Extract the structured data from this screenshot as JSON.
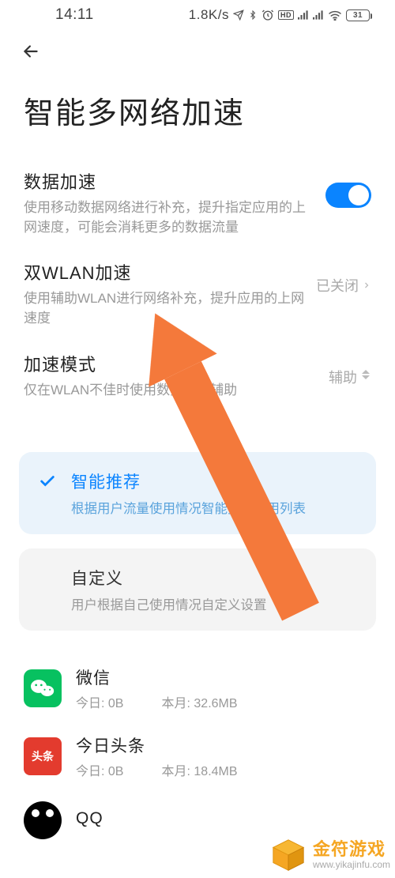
{
  "status": {
    "time": "14:11",
    "net_speed": "1.8K/s",
    "battery_pct": "31"
  },
  "header": {
    "title": "智能多网络加速"
  },
  "settings": {
    "data_accel": {
      "title": "数据加速",
      "desc": "使用移动数据网络进行补充，提升指定应用的上网速度，可能会消耗更多的数据流量",
      "enabled": true
    },
    "dual_wlan": {
      "title": "双WLAN加速",
      "desc": "使用辅助WLAN进行网络补充，提升应用的上网速度",
      "value": "已关闭"
    },
    "mode": {
      "title": "加速模式",
      "desc": "仅在WLAN不佳时使用数据流量辅助",
      "value": "辅助"
    }
  },
  "cards": {
    "recommend": {
      "title": "智能推荐",
      "desc": "根据用户流量使用情况智能推荐应用列表",
      "selected": true
    },
    "custom": {
      "title": "自定义",
      "desc": "用户根据自己使用情况自定义设置",
      "selected": false
    }
  },
  "apps": [
    {
      "icon": "wechat",
      "name": "微信",
      "today_label": "今日:",
      "today_value": "0B",
      "month_label": "本月:",
      "month_value": "32.6MB"
    },
    {
      "icon": "toutiao",
      "name": "今日头条",
      "icon_text": "头条",
      "today_label": "今日:",
      "today_value": "0B",
      "month_label": "本月:",
      "month_value": "18.4MB"
    },
    {
      "icon": "qq",
      "name": "QQ"
    }
  ],
  "watermark": {
    "brand": "金符游戏",
    "url": "www.yikajinfu.com"
  }
}
